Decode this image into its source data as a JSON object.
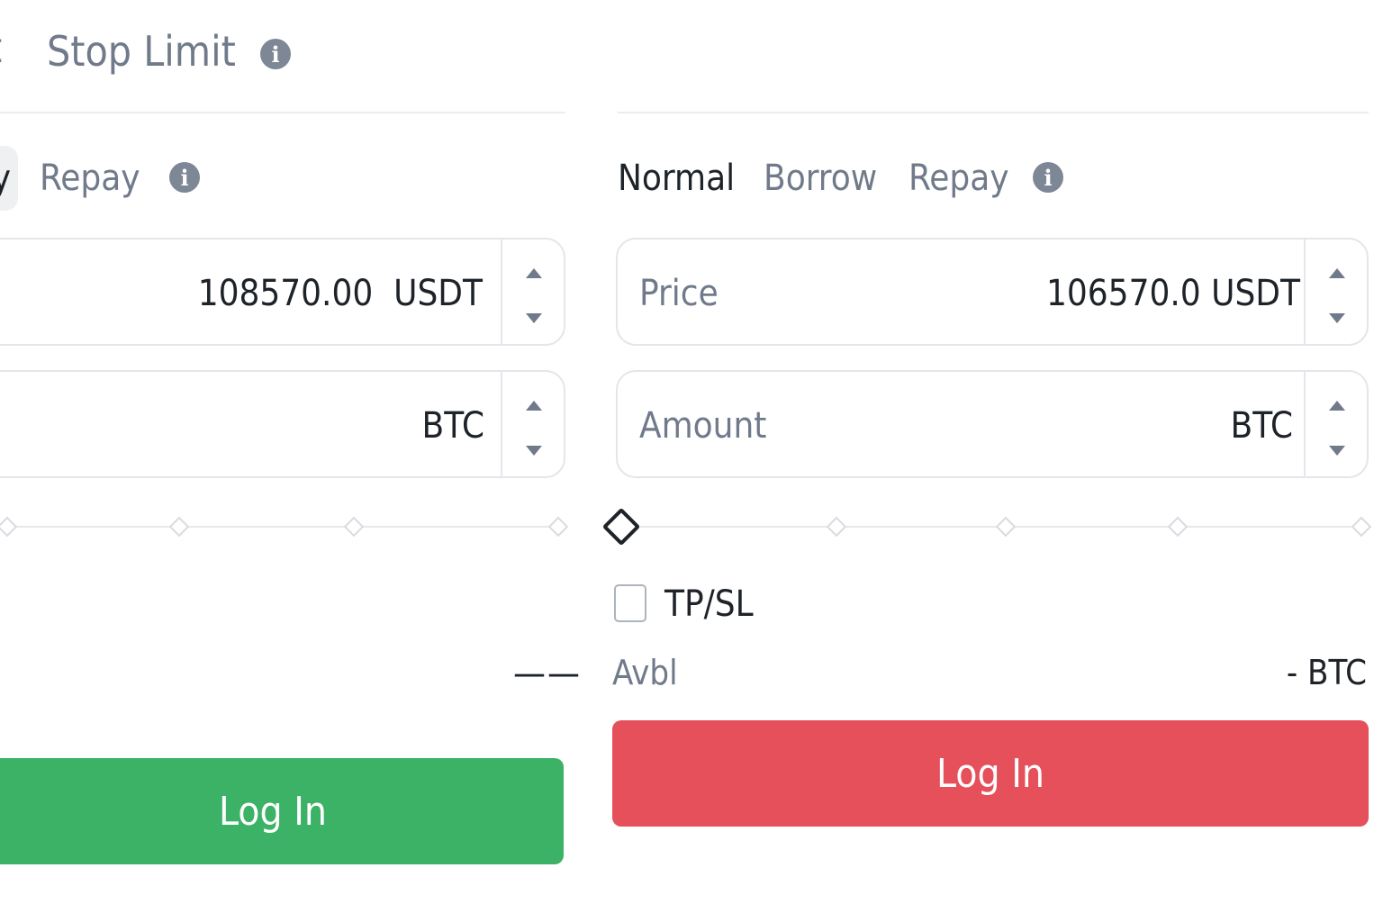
{
  "order_types": {
    "cut_label": "t",
    "stop_limit": "Stop Limit"
  },
  "buy_panel": {
    "mode_cut": "y",
    "repay": "Repay",
    "price_value": "108570.00",
    "price_unit": "USDT",
    "amount_unit": "BTC",
    "avbl_value": "——",
    "login": "Log In"
  },
  "sell_panel": {
    "modes": [
      "Normal",
      "Borrow",
      "Repay"
    ],
    "active_mode": "Normal",
    "price_label": "Price",
    "price_value": "106570.0",
    "price_unit": "USDT",
    "amount_label": "Amount",
    "amount_unit": "BTC",
    "tpsl": "TP/SL",
    "avbl_label": "Avbl",
    "avbl_value": "- BTC",
    "login": "Log In"
  },
  "slider": {
    "level_percent": 0
  },
  "colors": {
    "buy": "#3bb266",
    "sell": "#e5505a",
    "muted_text": "#707a8a",
    "primary_text": "#1e2329"
  },
  "icons": {
    "info": "info-icon",
    "stepper_up": "caret-up-icon",
    "stepper_down": "caret-down-icon"
  }
}
